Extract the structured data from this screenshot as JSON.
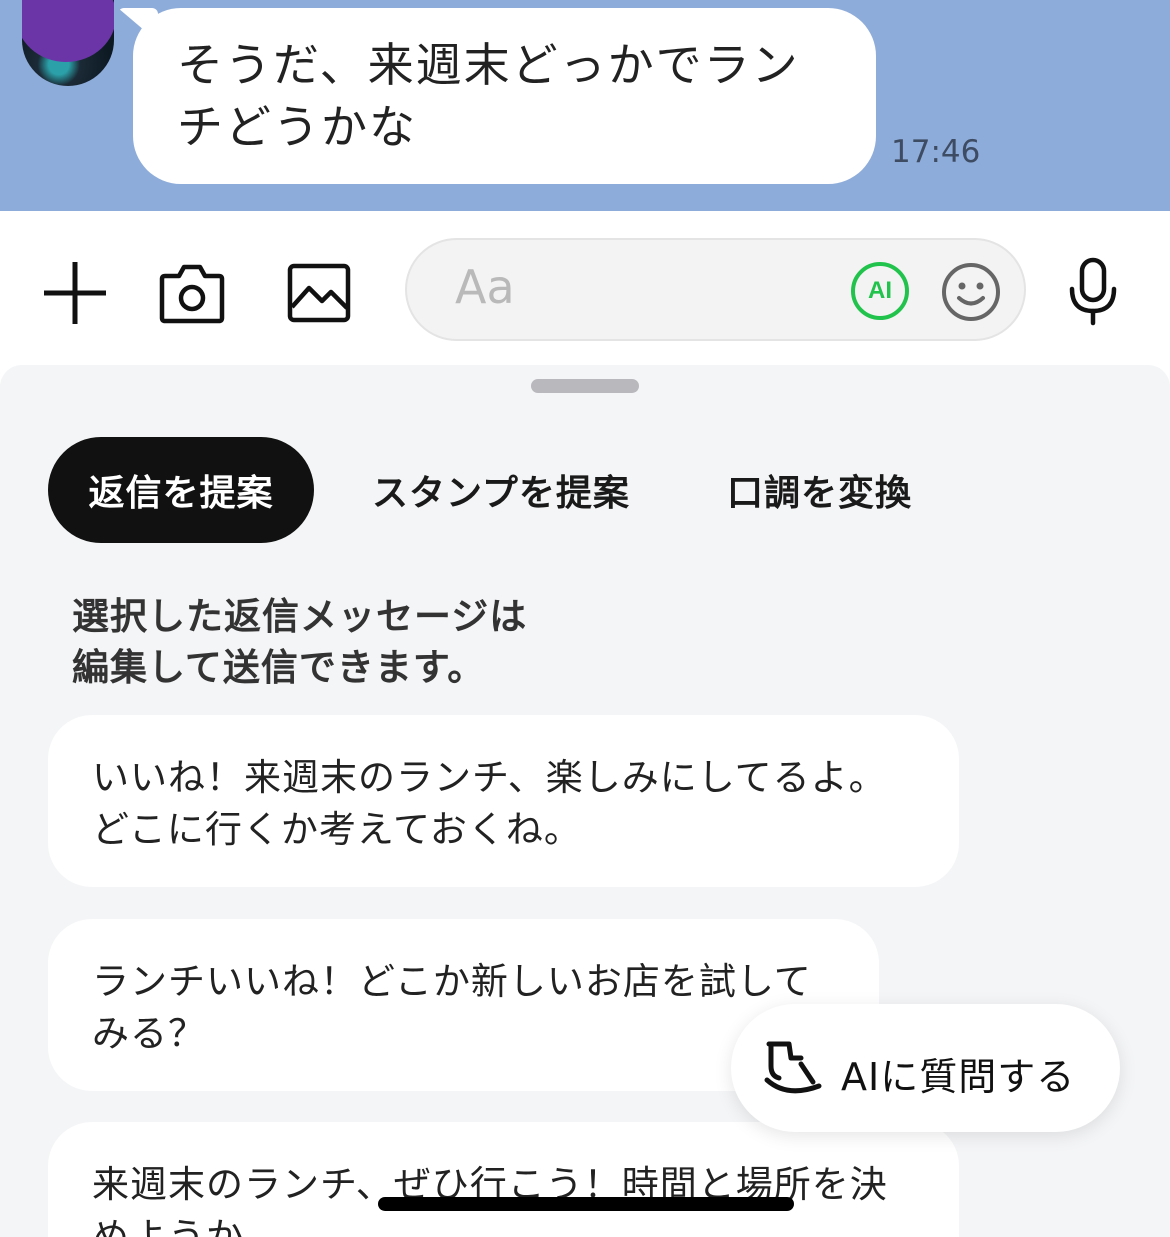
{
  "chat": {
    "message_text": "そうだ、来週末どっかでランチどうかな",
    "timestamp": "17:46"
  },
  "input": {
    "placeholder": "Aa",
    "ai_label": "AI"
  },
  "tabs": [
    {
      "label": "返信を提案",
      "active": true
    },
    {
      "label": "スタンプを提案",
      "active": false
    },
    {
      "label": "口調を変換",
      "active": false
    }
  ],
  "helper_text": "選択した返信メッセージは\n編集して送信できます。",
  "suggestions": [
    {
      "text": "いいね！来週末のランチ、楽しみにしてるよ。どこに行くか考えておくね。"
    },
    {
      "text": "ランチいいね！どこか新しいお店を試してみる？"
    },
    {
      "text": "来週末のランチ、ぜひ行こう！時間と場所を決めようか"
    }
  ],
  "ai_ask": {
    "label": "AIに質問する"
  },
  "colors": {
    "chat_background": "#8eacda",
    "ai_green": "#22c34d",
    "active_tab": "#111111",
    "sheet_background": "#f4f5f7"
  }
}
